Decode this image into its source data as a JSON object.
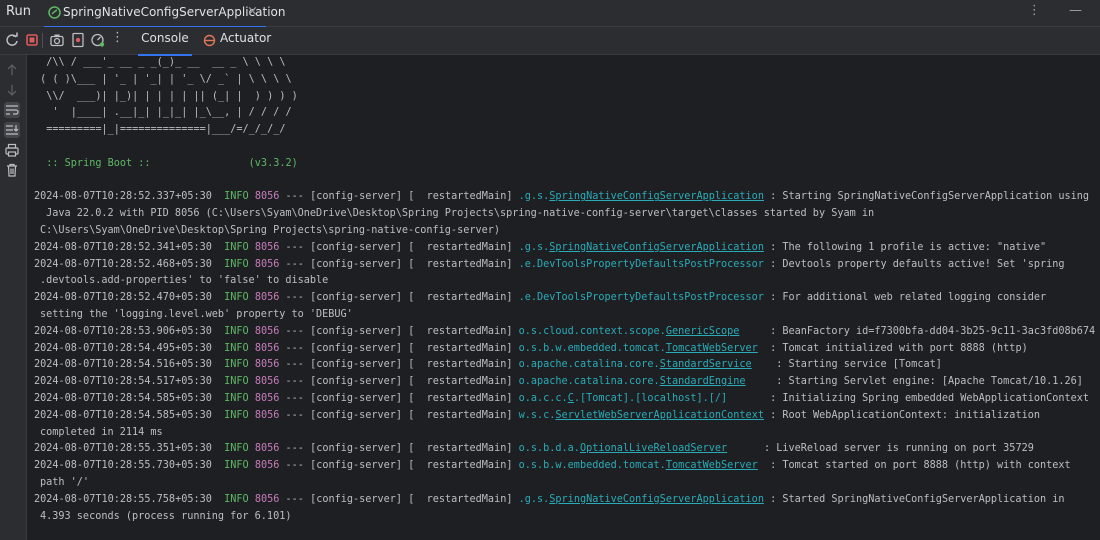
{
  "window": {
    "run_label": "Run",
    "tab_title": "SpringNativeConfigServerApplication",
    "tab_close": "×",
    "more_menu": "⋮ —"
  },
  "toolbar": {
    "console_label": "Console",
    "actuator_label": "Actuator",
    "more": "⋮"
  },
  "colors": {
    "background": "#1e1f22",
    "panel": "#2b2d30",
    "info": "#5fb865",
    "pid": "#c77dbb",
    "logger": "#2aacb8",
    "accent": "#3574f0"
  },
  "banner": [
    "  /\\\\ / ___'_ __ _ _(_)_ __  __ _ \\ \\ \\ \\",
    " ( ( )\\___ | '_ | '_| | '_ \\/ _` | \\ \\ \\ \\",
    "  \\\\/  ___)| |_)| | | | | || (_| |  ) ) ) )",
    "   '  |____| .__|_| |_|_| |_\\__, | / / / /",
    "  =========|_|==============|___/=/_/_/_/",
    "",
    "  :: Spring Boot ::                (v3.3.2)"
  ],
  "logs": [
    {
      "ts": "2024-08-07T10:28:52.337+05:30",
      "level": "INFO",
      "pid": "8056",
      "ctx": "--- [config-server] [  restartedMain]",
      "logger_prefix": ".g.s.",
      "logger_link": "SpringNativeConfigServerApplication",
      "pad": " ",
      "message": ": Starting SpringNativeConfigServerApplication using",
      "cont": [
        " Java 22.0.2 with PID 8056 (C:\\Users\\Syam\\OneDrive\\Desktop\\Spring Projects\\spring-native-config-server\\target\\classes started by Syam in",
        "C:\\Users\\Syam\\OneDrive\\Desktop\\Spring Projects\\spring-native-config-server)"
      ]
    },
    {
      "ts": "2024-08-07T10:28:52.341+05:30",
      "level": "INFO",
      "pid": "8056",
      "ctx": "--- [config-server] [  restartedMain]",
      "logger_prefix": ".g.s.",
      "logger_link": "SpringNativeConfigServerApplication",
      "pad": " ",
      "message": ": The following 1 profile is active: \"native\"",
      "cont": []
    },
    {
      "ts": "2024-08-07T10:28:52.468+05:30",
      "level": "INFO",
      "pid": "8056",
      "ctx": "--- [config-server] [  restartedMain]",
      "logger_prefix": ".e.DevToolsPropertyDefaultsPostProcessor",
      "logger_link": "",
      "pad": " ",
      "message": ": Devtools property defaults active! Set 'spring",
      "cont": [
        ".devtools.add-properties' to 'false' to disable"
      ]
    },
    {
      "ts": "2024-08-07T10:28:52.470+05:30",
      "level": "INFO",
      "pid": "8056",
      "ctx": "--- [config-server] [  restartedMain]",
      "logger_prefix": ".e.DevToolsPropertyDefaultsPostProcessor",
      "logger_link": "",
      "pad": " ",
      "message": ": For additional web related logging consider",
      "cont": [
        "setting the 'logging.level.web' property to 'DEBUG'"
      ]
    },
    {
      "ts": "2024-08-07T10:28:53.906+05:30",
      "level": "INFO",
      "pid": "8056",
      "ctx": "--- [config-server] [  restartedMain]",
      "logger_prefix": "o.s.cloud.context.scope.",
      "logger_link": "GenericScope",
      "pad": "     ",
      "message": ": BeanFactory id=f7300bfa-dd04-3b25-9c11-3ac3fd08b674",
      "cont": []
    },
    {
      "ts": "2024-08-07T10:28:54.495+05:30",
      "level": "INFO",
      "pid": "8056",
      "ctx": "--- [config-server] [  restartedMain]",
      "logger_prefix": "o.s.b.w.embedded.tomcat.",
      "logger_link": "TomcatWebServer",
      "pad": "  ",
      "message": ": Tomcat initialized with port 8888 (http)",
      "cont": []
    },
    {
      "ts": "2024-08-07T10:28:54.516+05:30",
      "level": "INFO",
      "pid": "8056",
      "ctx": "--- [config-server] [  restartedMain]",
      "logger_prefix": "o.apache.catalina.core.",
      "logger_link": "StandardService",
      "pad": "    ",
      "message": ": Starting service [Tomcat]",
      "cont": []
    },
    {
      "ts": "2024-08-07T10:28:54.517+05:30",
      "level": "INFO",
      "pid": "8056",
      "ctx": "--- [config-server] [  restartedMain]",
      "logger_prefix": "o.apache.catalina.core.",
      "logger_link": "StandardEngine",
      "pad": "     ",
      "message": ": Starting Servlet engine: [Apache Tomcat/10.1.26]",
      "cont": []
    },
    {
      "ts": "2024-08-07T10:28:54.585+05:30",
      "level": "INFO",
      "pid": "8056",
      "ctx": "--- [config-server] [  restartedMain]",
      "logger_prefix": "o.a.c.c.",
      "logger_link": "C",
      "logger_suffix": ".[Tomcat].[localhost].[/]",
      "pad": "       ",
      "message": ": Initializing Spring embedded WebApplicationContext",
      "cont": []
    },
    {
      "ts": "2024-08-07T10:28:54.585+05:30",
      "level": "INFO",
      "pid": "8056",
      "ctx": "--- [config-server] [  restartedMain]",
      "logger_prefix": "w.s.c.",
      "logger_link": "ServletWebServerApplicationContext",
      "pad": " ",
      "message": ": Root WebApplicationContext: initialization",
      "cont": [
        "completed in 2114 ms"
      ]
    },
    {
      "ts": "2024-08-07T10:28:55.351+05:30",
      "level": "INFO",
      "pid": "8056",
      "ctx": "--- [config-server] [  restartedMain]",
      "logger_prefix": "o.s.b.d.a.",
      "logger_link": "OptionalLiveReloadServer",
      "pad": "      ",
      "message": ": LiveReload server is running on port 35729",
      "cont": []
    },
    {
      "ts": "2024-08-07T10:28:55.730+05:30",
      "level": "INFO",
      "pid": "8056",
      "ctx": "--- [config-server] [  restartedMain]",
      "logger_prefix": "o.s.b.w.embedded.tomcat.",
      "logger_link": "TomcatWebServer",
      "pad": "  ",
      "message": ": Tomcat started on port 8888 (http) with context",
      "cont": [
        "path '/'"
      ]
    },
    {
      "ts": "2024-08-07T10:28:55.758+05:30",
      "level": "INFO",
      "pid": "8056",
      "ctx": "--- [config-server] [  restartedMain]",
      "logger_prefix": ".g.s.",
      "logger_link": "SpringNativeConfigServerApplication",
      "pad": " ",
      "message": ": Started SpringNativeConfigServerApplication in",
      "cont": [
        "4.393 seconds (process running for 6.101)"
      ]
    }
  ]
}
